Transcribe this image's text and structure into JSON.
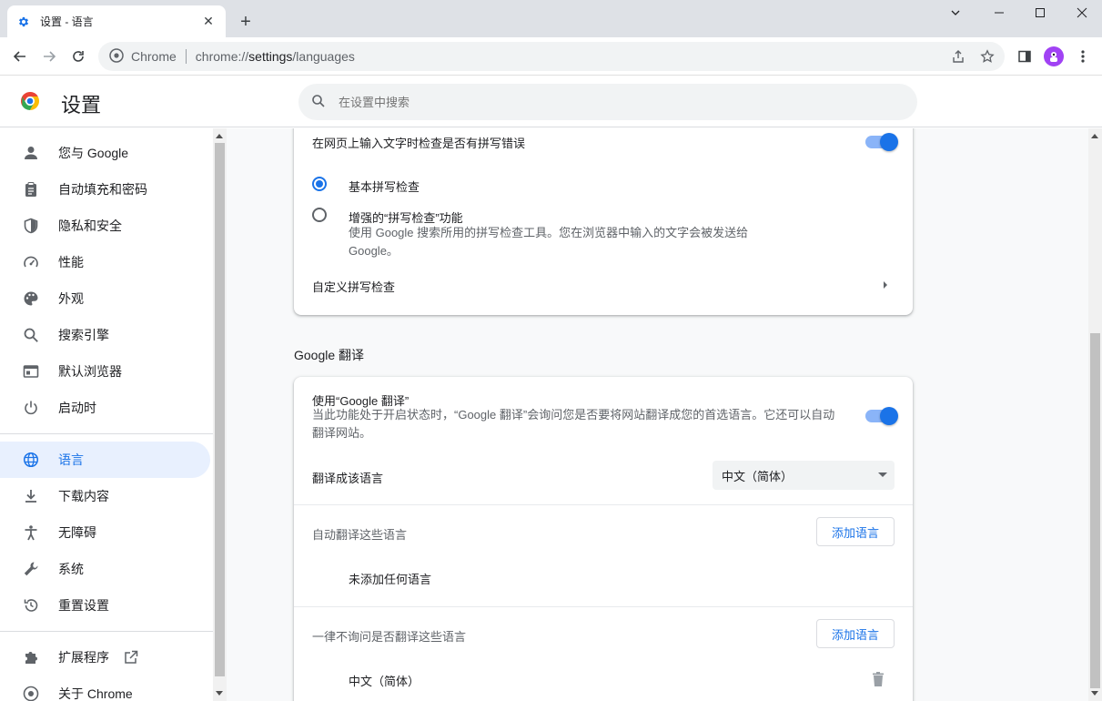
{
  "tab": {
    "title": "设置 - 语言",
    "close": "✕"
  },
  "new_tab": "+",
  "omnibox": {
    "site": "Chrome",
    "url_scheme": "chrome://",
    "url_host": "settings",
    "url_path": "/languages"
  },
  "header": {
    "title": "设置",
    "search_placeholder": "在设置中搜索"
  },
  "sidebar": {
    "items": [
      {
        "label": "您与 Google",
        "icon": "person-icon"
      },
      {
        "label": "自动填充和密码",
        "icon": "clipboard-icon"
      },
      {
        "label": "隐私和安全",
        "icon": "shield-icon"
      },
      {
        "label": "性能",
        "icon": "gauge-icon"
      },
      {
        "label": "外观",
        "icon": "palette-icon"
      },
      {
        "label": "搜索引擎",
        "icon": "search-icon"
      },
      {
        "label": "默认浏览器",
        "icon": "browser-icon"
      },
      {
        "label": "启动时",
        "icon": "power-icon"
      },
      {
        "label": "语言",
        "icon": "globe-icon",
        "active": true
      },
      {
        "label": "下载内容",
        "icon": "download-icon"
      },
      {
        "label": "无障碍",
        "icon": "accessibility-icon"
      },
      {
        "label": "系统",
        "icon": "wrench-icon"
      },
      {
        "label": "重置设置",
        "icon": "reset-icon"
      },
      {
        "label": "扩展程序",
        "icon": "puzzle-icon"
      },
      {
        "label": "关于 Chrome",
        "icon": "chrome-icon"
      }
    ]
  },
  "spellcheck": {
    "toggle_label": "在网页上输入文字时检查是否有拼写错误",
    "toggle_on": true,
    "basic_label": "基本拼写检查",
    "enhanced_label": "增强的“拼写检查”功能",
    "enhanced_desc_line1": "使用 Google 搜索所用的拼写检查工具。您在浏览器中输入的文字会被发送给",
    "enhanced_desc_line2": "Google。",
    "customize_label": "自定义拼写检查",
    "selected": "basic"
  },
  "translate": {
    "section_title": "Google 翻译",
    "use_label": "使用“Google 翻译”",
    "use_desc_line1": "当此功能处于开启状态时，“Google 翻译”会询问您是否要将网站翻译成您的首选语言。它还可以自动",
    "use_desc_line2": "翻译网站。",
    "toggle_on": true,
    "target_label": "翻译成该语言",
    "target_value": "中文（简体）",
    "auto_label": "自动翻译这些语言",
    "add_button": "添加语言",
    "auto_empty": "未添加任何语言",
    "never_label": "一律不询问是否翻译这些语言",
    "never_item": "中文（简体）"
  }
}
